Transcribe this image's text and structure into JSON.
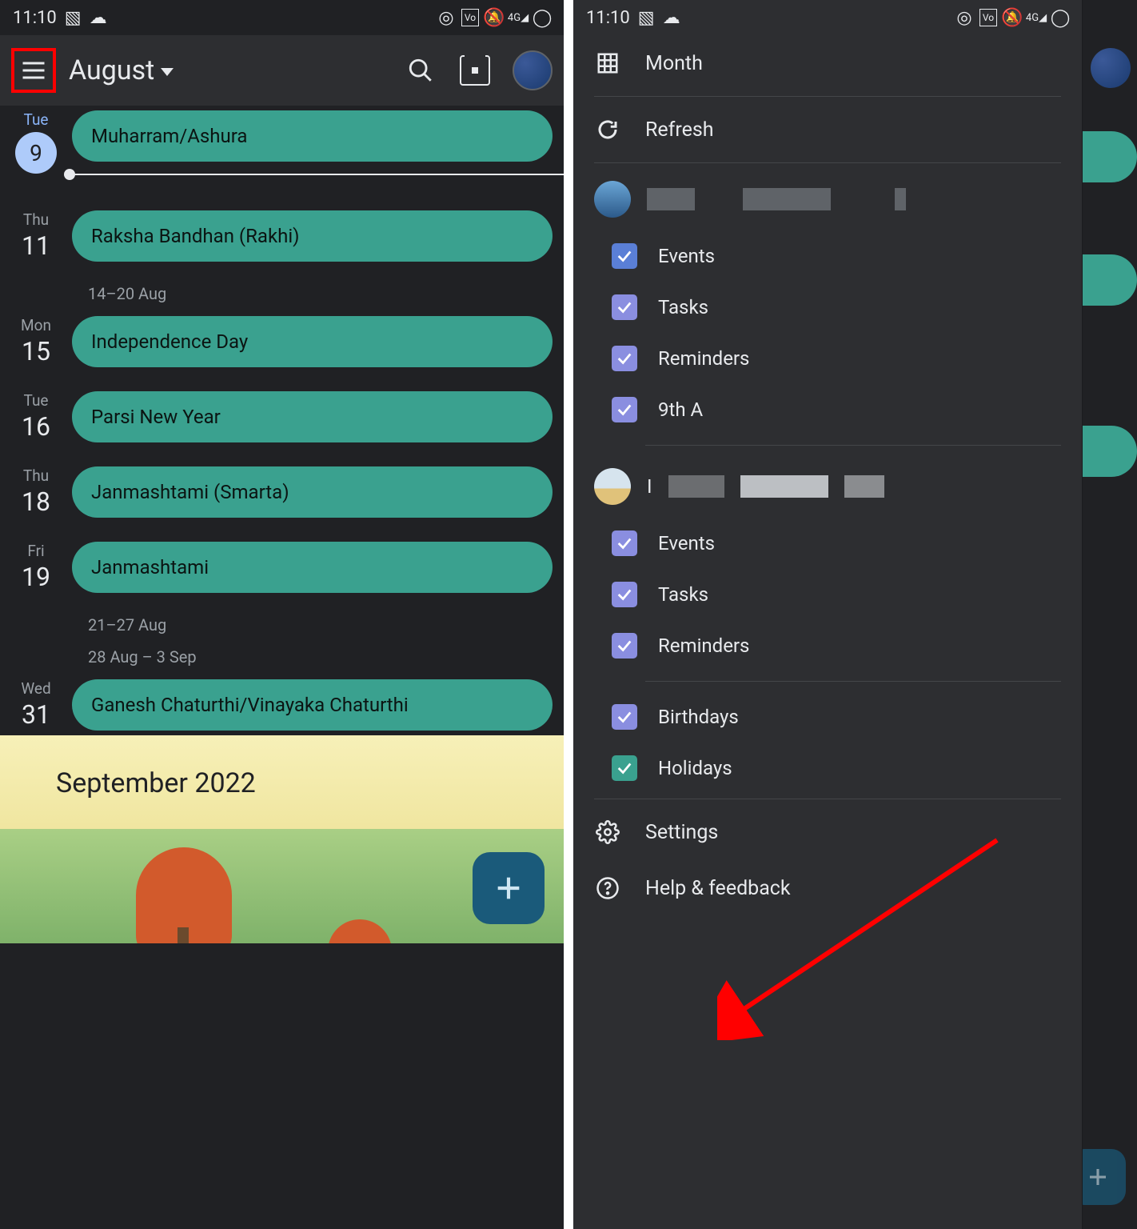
{
  "status": {
    "time": "11:10"
  },
  "left": {
    "header": {
      "month_label": "August"
    },
    "today": {
      "dow": "Tue",
      "dom": "9"
    },
    "days": [
      {
        "dow": "Thu",
        "dom": "11",
        "event": "Raksha Bandhan (Rakhi)"
      },
      {
        "range": "14–20 Aug"
      },
      {
        "dow": "Mon",
        "dom": "15",
        "event": "Independence Day"
      },
      {
        "dow": "Tue",
        "dom": "16",
        "event": "Parsi New Year"
      },
      {
        "dow": "Thu",
        "dom": "18",
        "event": "Janmashtami (Smarta)"
      },
      {
        "dow": "Fri",
        "dom": "19",
        "event": "Janmashtami"
      },
      {
        "range": "21–27 Aug"
      },
      {
        "range": "28 Aug – 3 Sep"
      },
      {
        "dow": "Wed",
        "dom": "31",
        "event": "Ganesh Chaturthi/Vinayaka Chaturthi"
      }
    ],
    "today_event": "Muharram/Ashura",
    "next_month_label": "September 2022"
  },
  "drawer": {
    "month_label": "Month",
    "refresh_label": "Refresh",
    "acct1": {
      "checks": [
        {
          "label": "Events",
          "color": "blue"
        },
        {
          "label": "Tasks",
          "color": "purple"
        },
        {
          "label": "Reminders",
          "color": "purple"
        },
        {
          "label": "9th A",
          "color": "purple"
        }
      ]
    },
    "acct2": {
      "checks": [
        {
          "label": "Events",
          "color": "purple"
        },
        {
          "label": "Tasks",
          "color": "purple"
        },
        {
          "label": "Reminders",
          "color": "purple"
        }
      ],
      "extra": [
        {
          "label": "Birthdays",
          "color": "purple"
        },
        {
          "label": "Holidays",
          "color": "teal"
        }
      ]
    },
    "settings_label": "Settings",
    "help_label": "Help & feedback"
  }
}
